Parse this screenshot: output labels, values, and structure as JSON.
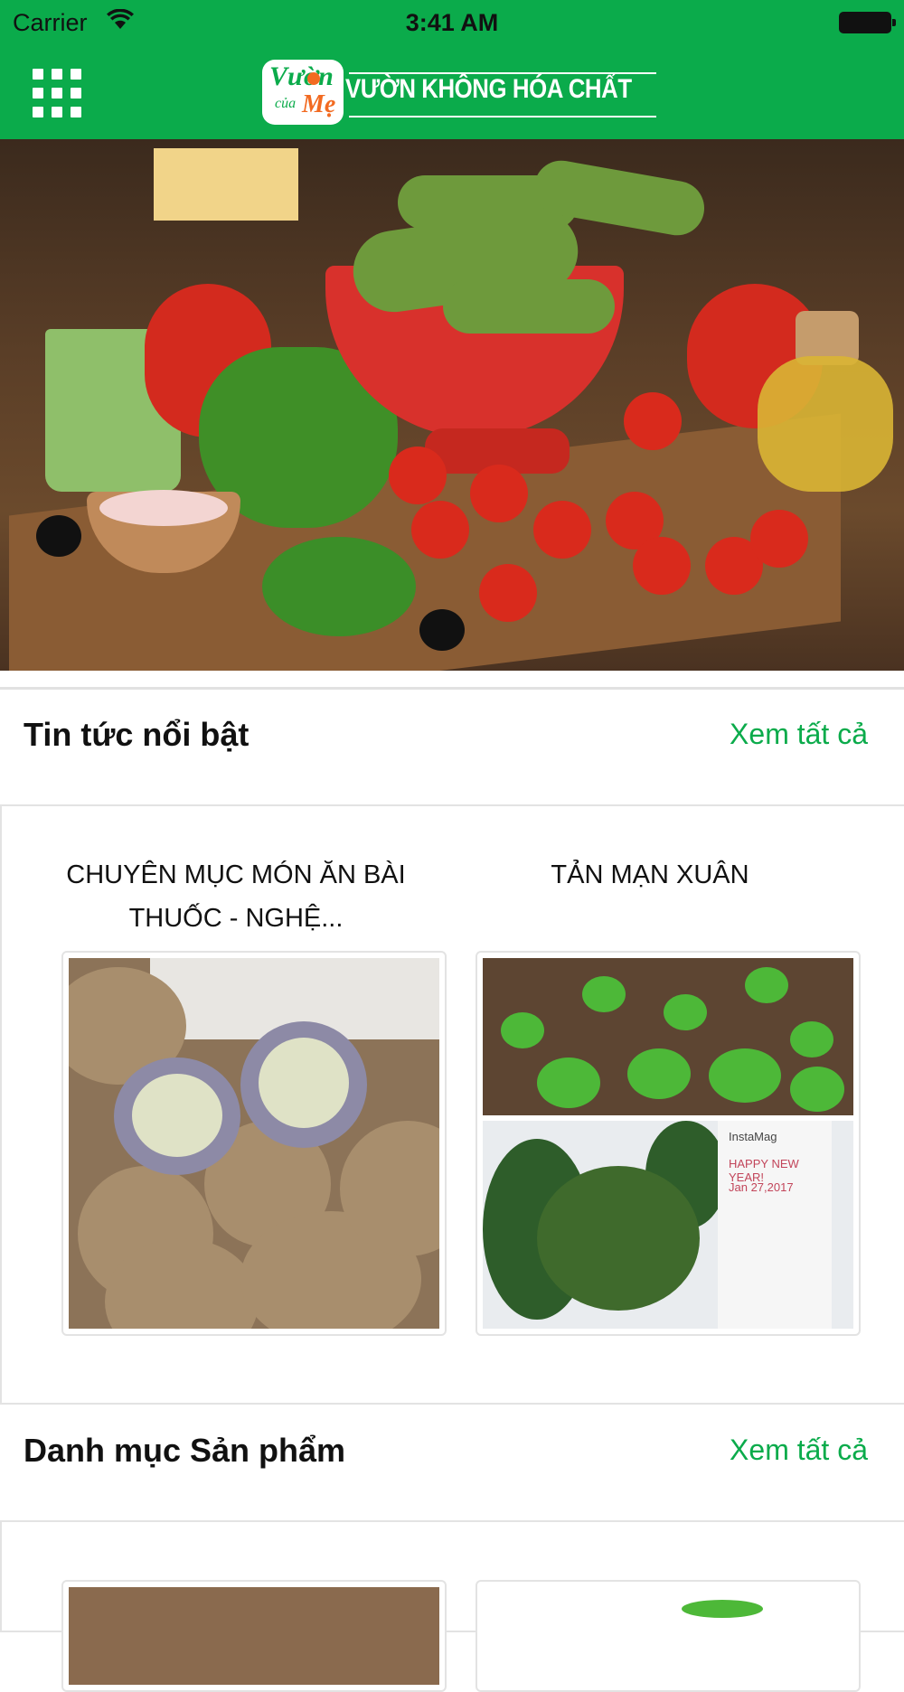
{
  "status_bar": {
    "carrier": "Carrier",
    "time": "3:41 AM"
  },
  "header": {
    "logo_brand": {
      "line1": "Vườn",
      "line2": "của",
      "line3": "Mẹ"
    },
    "logo_tagline": "VƯỜN KHÔNG HÓA CHẤT",
    "menu_icon": "grid-menu-icon",
    "background_color": "#0bab4b"
  },
  "hero": {
    "description_icon": "vegetables-banner-image"
  },
  "news_section": {
    "title": "Tin tức nổi bật",
    "see_all": "Xem tất cả",
    "items": [
      {
        "title": "CHUYÊN MỤC MÓN ĂN BÀI THUỐC - NGHỆ..."
      },
      {
        "title": "TẢN MẠN XUÂN"
      }
    ]
  },
  "thumbnail_texts": {
    "insta_name": "InstaMag",
    "insta_greeting": "HAPPY NEW YEAR!",
    "insta_date": "Jan 27,2017"
  },
  "products_section": {
    "title": "Danh mục Sản phẩm",
    "see_all": "Xem tất cả"
  },
  "accent_color": "#0bab4b"
}
